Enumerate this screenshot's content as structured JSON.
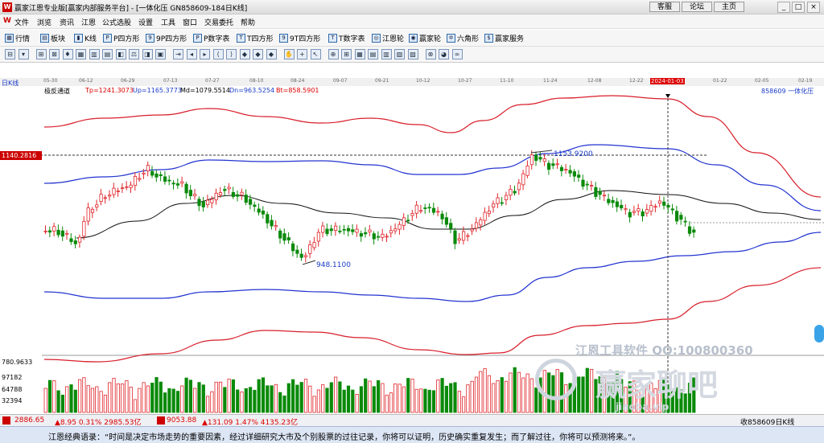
{
  "title": "赢家江恩专业版[赢家内部服务平台] - [一体化压  GN858609-184日K线]",
  "top_links": [
    "客服",
    "论坛",
    "主页"
  ],
  "window_controls": [
    "_",
    "□",
    "×"
  ],
  "menu": [
    "文件",
    "浏览",
    "资讯",
    "江恩",
    "公式选股",
    "设置",
    "工具",
    "窗口",
    "交易委托",
    "帮助"
  ],
  "toolbar1": [
    "行情",
    "板块",
    "K线",
    "P四方形",
    "9P四方形",
    "P数字表",
    "T四方形",
    "9T四方形",
    "T数字表",
    "江恩轮",
    "赢家轮",
    "六角形",
    "赢家服务"
  ],
  "toolbar1_icons": [
    "hq",
    "bk",
    "kx",
    "p4",
    "9p",
    "pn",
    "t4",
    "9t",
    "tn",
    "jl",
    "yl",
    "lj",
    "yf"
  ],
  "chart_label": "日K线",
  "dates": [
    "05-30",
    "06-12",
    "06-29",
    "07-13",
    "07-27",
    "08-10",
    "08-24",
    "09-07",
    "09-21",
    "10-12",
    "10-27",
    "11-10",
    "11-24",
    "12-08",
    "12-22",
    "2024-01-03",
    "01-22",
    "02-05",
    "02-19"
  ],
  "indicator": {
    "name": "极反通道",
    "tp": "Tp=1241.3073",
    "up": "Up=1165.3773",
    "md": "Md=1079.5514",
    "dn": "Dn=963.5254",
    "bt": "Bt=858.5901",
    "symbol": "858609 一体化压"
  },
  "price_tag": "1140.2816",
  "annotations": {
    "high": "1153.9200",
    "low": "948.1100"
  },
  "volume_axis": [
    "780.9633",
    "97182",
    "64788",
    "32394"
  ],
  "watermark": {
    "line1": "江恩工具软件  QQ:100800360",
    "line2": "赢家聊吧",
    "line3": "jiaoba.vip"
  },
  "status": {
    "sh": "2886.65",
    "sh_chg": "▲8.95 0.31% 2985.53亿",
    "sz": "9053.88",
    "sz_chg": "▲131.09 1.47% 4135.23亿",
    "right": "收858609日K线"
  },
  "quote": "江恩经典语录：“时间是决定市场走势的重要因素，经过详细研究大市及个别股票的过往记录，你将可以证明，历史确实重复发生；而了解过往，你将可以预测将来。”。",
  "colors": {
    "up_candle": "#e0262b",
    "down_candle": "#0a8a0a",
    "channel_outer": "#d81e2a",
    "channel_inner": "#2233d0",
    "mid": "#111111"
  }
}
